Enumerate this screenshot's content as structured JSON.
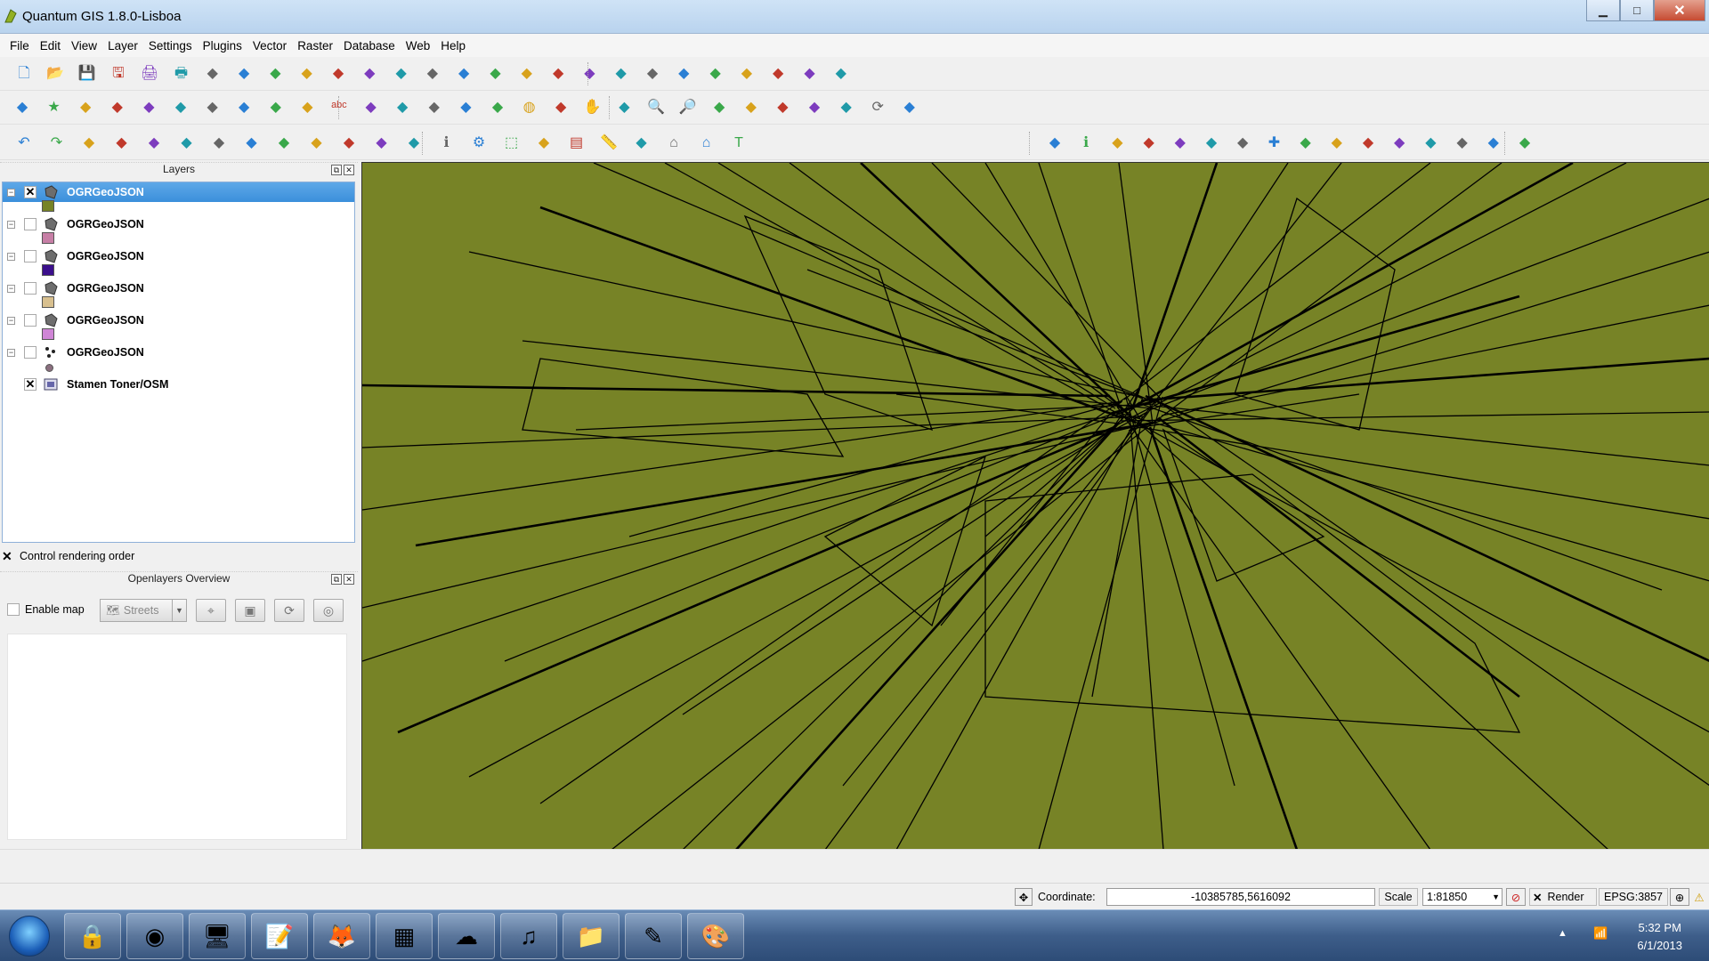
{
  "window": {
    "title": "Quantum GIS 1.8.0-Lisboa",
    "min": "▁",
    "max": "□",
    "close": "✕"
  },
  "menu": [
    "File",
    "Edit",
    "View",
    "Layer",
    "Settings",
    "Plugins",
    "Vector",
    "Raster",
    "Database",
    "Web",
    "Help"
  ],
  "toolbars": {
    "row1": [
      "new-project-icon",
      "open-project-icon",
      "save-project-icon",
      "save-as-icon",
      "print-composer-icon",
      "composer-manager-icon",
      "add-vector-layer-icon",
      "add-raster-layer-icon",
      "add-postgis-layer-icon",
      "add-spatialite-layer-icon",
      "add-mssql-layer-icon",
      "add-wms-layer-icon",
      "add-wcs-layer-icon",
      "new-shapefile-icon",
      "remove-layer-icon",
      "add-wfs-layer-icon",
      "add-delimited-text-icon",
      "add-oracle-layer-icon",
      "toggle-editing-icon",
      "save-edits-icon",
      "add-feature-icon",
      "move-feature-icon",
      "node-tool-icon",
      "delete-selected-icon",
      "cut-features-icon",
      "copy-features-icon",
      "paste-features-icon"
    ],
    "row2": [
      "capture-point-icon",
      "star-icon",
      "capture-polygon-icon",
      "digitize-icon",
      "digitize2-icon",
      "reshape-icon",
      "split-icon",
      "merge-icon",
      "offset-icon",
      "simplify-icon",
      "label-icon",
      "rotate-label-icon",
      "move-label-icon",
      "pin-label-icon",
      "show-hide-label-icon",
      "change-label-icon",
      "globe-icon",
      "map-tips-icon",
      "pan-icon",
      "pan-to-selection-icon",
      "zoom-in-icon",
      "zoom-out-icon",
      "zoom-full-icon",
      "zoom-layer-icon",
      "zoom-selection-icon",
      "zoom-last-icon",
      "zoom-next-icon",
      "refresh-icon",
      "zoom-native-icon"
    ],
    "row3": [
      "undo-icon",
      "redo-icon",
      "add-ring-icon",
      "add-part-icon",
      "fill-ring-icon",
      "delete-ring-icon",
      "delete-part-icon",
      "reshape-features-icon",
      "offset-curve-icon",
      "split-parts-icon",
      "merge-attributes-icon",
      "rotate-point-icon",
      "rotate-symbol-icon",
      "identify-icon",
      "settings-icon",
      "select-icon",
      "deselect-icon",
      "attribute-table-icon",
      "measure-icon",
      "annotation-icon",
      "home-icon",
      "home2-icon",
      "text-annotation-icon"
    ],
    "row3_right": [
      "db-manager-icon",
      "info-icon",
      "georef-icon",
      "gps-icon",
      "coordinate-capture-icon",
      "interpolation-icon",
      "heatmap-icon",
      "add-plugin-icon",
      "fTools-icon",
      "grass-icon",
      "road-graph-icon",
      "raster-calc-icon",
      "openlayers-icon",
      "spatial-query-icon",
      "sqlite-icon",
      "export-icon"
    ]
  },
  "layers_panel": {
    "title": "Layers",
    "layers": [
      {
        "name": "OGRGeoJSON",
        "checked": "✕",
        "color": "#778326",
        "type": "polygon",
        "selected": true
      },
      {
        "name": "OGRGeoJSON",
        "checked": "",
        "color": "#c77fa6",
        "type": "polygon",
        "selected": false
      },
      {
        "name": "OGRGeoJSON",
        "checked": "",
        "color": "#3b0f8c",
        "type": "polygon",
        "selected": false
      },
      {
        "name": "OGRGeoJSON",
        "checked": "",
        "color": "#d8c08f",
        "type": "polygon",
        "selected": false
      },
      {
        "name": "OGRGeoJSON",
        "checked": "",
        "color": "#cf85d6",
        "type": "polygon",
        "selected": false
      },
      {
        "name": "OGRGeoJSON",
        "checked": "",
        "color": "#8b6f7f",
        "type": "point",
        "selected": false
      },
      {
        "name": "Stamen Toner/OSM",
        "checked": "✕",
        "color": "",
        "type": "raster",
        "selected": false
      }
    ],
    "control_rendering": "Control rendering order",
    "control_rendering_checked": "✕"
  },
  "openlayers_panel": {
    "title": "Openlayers Overview",
    "enable_map": "Enable map",
    "map_type": "Streets"
  },
  "status": {
    "coordinate_label": "Coordinate:",
    "coordinate_value": "-10385785,5616092",
    "scale_label": "Scale",
    "scale_value": "1:81850",
    "render_label": "Render",
    "render_checked": "✕",
    "crs": "EPSG:3857"
  },
  "taskbar": {
    "time": "5:32 PM",
    "date": "6/1/2013",
    "apps": [
      "keepass-icon",
      "chrome-icon",
      "remote-desktop-icon",
      "notepad-icon",
      "firefox-icon",
      "terminal-icon",
      "cloud-icon",
      "itunes-icon",
      "explorer-icon",
      "qgis-icon",
      "paint-icon"
    ]
  },
  "colors": {
    "map_fill": "#778326",
    "selection": "#3b8fdb"
  }
}
